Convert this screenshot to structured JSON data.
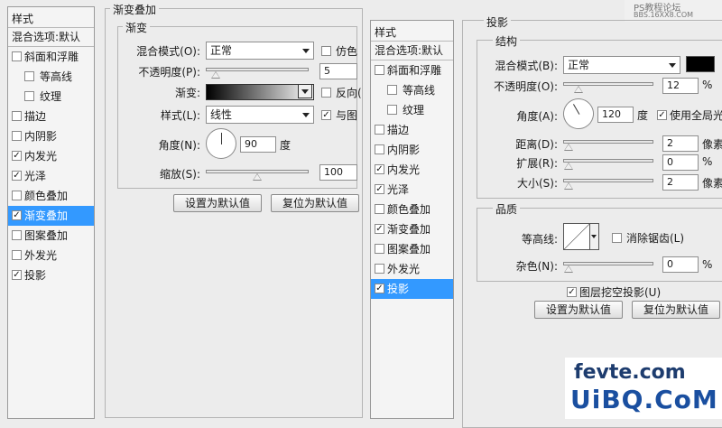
{
  "watermark_top": {
    "line1": "PS教程论坛",
    "line2": "BBS.16XX8.COM"
  },
  "left_list": {
    "header": "样式",
    "default_row": "混合选项:默认",
    "items": [
      {
        "label": "斜面和浮雕",
        "checked": false,
        "sub": false,
        "selected": false
      },
      {
        "label": "等高线",
        "checked": false,
        "sub": true,
        "selected": false
      },
      {
        "label": "纹理",
        "checked": false,
        "sub": true,
        "selected": false
      },
      {
        "label": "描边",
        "checked": false,
        "sub": false,
        "selected": false
      },
      {
        "label": "内阴影",
        "checked": false,
        "sub": false,
        "selected": false
      },
      {
        "label": "内发光",
        "checked": true,
        "sub": false,
        "selected": false
      },
      {
        "label": "光泽",
        "checked": true,
        "sub": false,
        "selected": false
      },
      {
        "label": "颜色叠加",
        "checked": false,
        "sub": false,
        "selected": false
      },
      {
        "label": "渐变叠加",
        "checked": true,
        "sub": false,
        "selected": true
      },
      {
        "label": "图案叠加",
        "checked": false,
        "sub": false,
        "selected": false
      },
      {
        "label": "外发光",
        "checked": false,
        "sub": false,
        "selected": false
      },
      {
        "label": "投影",
        "checked": true,
        "sub": false,
        "selected": false
      }
    ]
  },
  "gradient_overlay": {
    "title": "渐变叠加",
    "group": "渐变",
    "blend_mode_label": "混合模式(O):",
    "blend_mode_value": "正常",
    "dither_label": "仿色",
    "opacity_label": "不透明度(P):",
    "opacity_value": "5",
    "opacity_level": 0.05,
    "gradient_label": "渐变:",
    "reverse_label": "反向(",
    "style_label": "样式(L):",
    "style_value": "线性",
    "align_label": "与图",
    "angle_label": "角度(N):",
    "angle_value": "90",
    "degree": "度",
    "scale_label": "缩放(S):",
    "scale_value": "100",
    "scale_level": 0.5,
    "reset_default": "设置为默认值",
    "restore_default": "复位为默认值"
  },
  "right_list": {
    "header": "样式",
    "default_row": "混合选项:默认",
    "items": [
      {
        "label": "斜面和浮雕",
        "checked": false,
        "sub": false,
        "selected": false
      },
      {
        "label": "等高线",
        "checked": false,
        "sub": true,
        "selected": false
      },
      {
        "label": "纹理",
        "checked": false,
        "sub": true,
        "selected": false
      },
      {
        "label": "描边",
        "checked": false,
        "sub": false,
        "selected": false
      },
      {
        "label": "内阴影",
        "checked": false,
        "sub": false,
        "selected": false
      },
      {
        "label": "内发光",
        "checked": true,
        "sub": false,
        "selected": false
      },
      {
        "label": "光泽",
        "checked": true,
        "sub": false,
        "selected": false
      },
      {
        "label": "颜色叠加",
        "checked": false,
        "sub": false,
        "selected": false
      },
      {
        "label": "渐变叠加",
        "checked": true,
        "sub": false,
        "selected": false
      },
      {
        "label": "图案叠加",
        "checked": false,
        "sub": false,
        "selected": false
      },
      {
        "label": "外发光",
        "checked": false,
        "sub": false,
        "selected": false
      },
      {
        "label": "投影",
        "checked": true,
        "sub": false,
        "selected": true
      }
    ]
  },
  "drop_shadow": {
    "title": "投影",
    "structure_group": "结构",
    "blend_mode_label": "混合模式(B):",
    "blend_mode_value": "正常",
    "shadow_color": "#000000",
    "opacity_label": "不透明度(O):",
    "opacity_value": "12",
    "opacity_level": 0.12,
    "percent": "%",
    "angle_label": "角度(A):",
    "angle_value": "120",
    "degree": "度",
    "global_light_label": "使用全局光",
    "distance_label": "距离(D):",
    "distance_value": "2",
    "distance_level": 0.0,
    "pixels": "像素",
    "spread_label": "扩展(R):",
    "spread_value": "0",
    "spread_level": 0.0,
    "size_label": "大小(S):",
    "size_value": "2",
    "size_level": 0.0,
    "quality_group": "品质",
    "contour_label": "等高线:",
    "antialias_label": "消除锯齿(L)",
    "noise_label": "杂色(N):",
    "noise_value": "0",
    "noise_level": 0.0,
    "knockout_label": "图层挖空投影(U)",
    "reset_default": "设置为默认值",
    "restore_default": "复位为默认值"
  },
  "watermark_bottom": {
    "line1": "fevte.com",
    "line2": "UiBQ.CoM"
  }
}
